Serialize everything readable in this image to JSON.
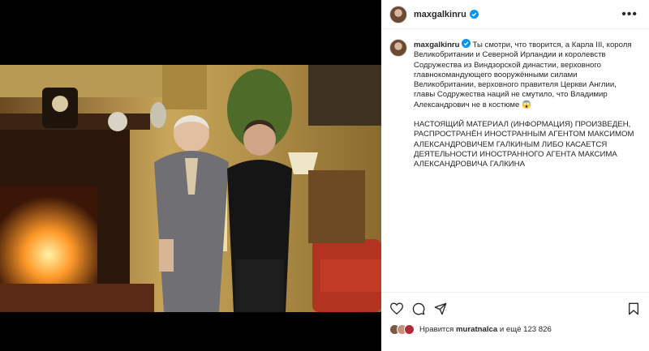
{
  "post": {
    "username": "maxgalkinru",
    "more_icon": "more-horizontal-icon",
    "caption_main": "Ты смотри, что творится, а Карла III, короля Великобритании и Северной Ирландии и королевств Содружества из Виндзорской династии, верховного главнокомандующего вооружёнными силами Великобритании, верховного правителя Церкви Англии, главы Содружества наций не смутило, что Владимир Александрович не в костюме 😱",
    "caption_notice": "НАСТОЯЩИЙ МАТЕРИАЛ (ИНФОРМАЦИЯ) ПРОИЗВЕДЕН, РАСПРОСТРАНЁН ИНОСТРАННЫМ АГЕНТОМ МАКСИМОМ АЛЕКСАНДРОВИЧЕМ ГАЛКИНЫМ ЛИБО КАСАЕТСЯ ДЕЯТЕЛЬНОСТИ ИНОСТРАННОГО АГЕНТА МАКСИМА АЛЕКСАНДРОВИЧА ГАЛКИНА"
  },
  "likes": {
    "prefix": "Нравится",
    "user": "muratnalca",
    "suffix": "и ещё 123 826"
  },
  "colors": {
    "verified_blue": "#0095f6",
    "border": "#efefef",
    "text": "#262626"
  }
}
